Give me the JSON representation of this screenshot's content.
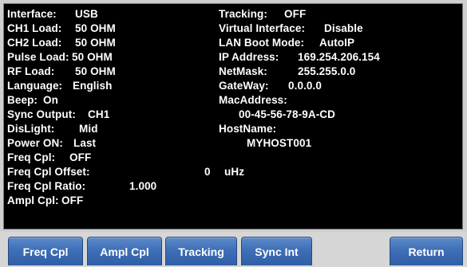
{
  "left_column": [
    {
      "label": "Interface:",
      "value": "USB"
    },
    {
      "label": "CH1 Load:",
      "value": "50 OHM"
    },
    {
      "label": "CH2 Load:",
      "value": "50 OHM"
    },
    {
      "label": "Pulse Load:",
      "value": "50 OHM"
    },
    {
      "label": "RF Load:",
      "value": "50 OHM"
    },
    {
      "label": "Language:",
      "value": "English"
    },
    {
      "label": "Beep:",
      "value": "On"
    },
    {
      "label": "Sync Output:",
      "value": "CH1"
    },
    {
      "label": "DisLight:",
      "value": "Mid"
    },
    {
      "label": "Power ON:",
      "value": "Last"
    },
    {
      "label": "Freq Cpl:",
      "value": "OFF"
    },
    {
      "label": "Freq Cpl Offset:",
      "value": "0",
      "unit": "uHz"
    },
    {
      "label": "Freq Cpl Ratio:",
      "value": "1.000"
    },
    {
      "label": "Ampl Cpl:",
      "value": "OFF"
    }
  ],
  "right_column": [
    {
      "label": "Tracking:",
      "value": "OFF"
    },
    {
      "label": "Virtual Interface:",
      "value": "Disable"
    },
    {
      "label": "LAN Boot Mode:",
      "value": "AutoIP"
    },
    {
      "label": "IP Address:",
      "value": "169.254.206.154"
    },
    {
      "label": "NetMask:",
      "value": "255.255.0.0"
    },
    {
      "label": "GateWay:",
      "value": "0.0.0.0"
    },
    {
      "label": "MacAddress:",
      "value": "00-45-56-78-9A-CD"
    },
    {
      "label": "HostName:",
      "value": "MYHOST001"
    }
  ],
  "softkeys": [
    {
      "label": "Freq Cpl"
    },
    {
      "label": "Ampl Cpl"
    },
    {
      "label": "Tracking"
    },
    {
      "label": "Sync Int"
    },
    {
      "label": ""
    },
    {
      "label": "Return"
    }
  ],
  "colors": {
    "screen_background": "#000000",
    "text": "#ffffff",
    "softkey": "#3f6fb7"
  }
}
